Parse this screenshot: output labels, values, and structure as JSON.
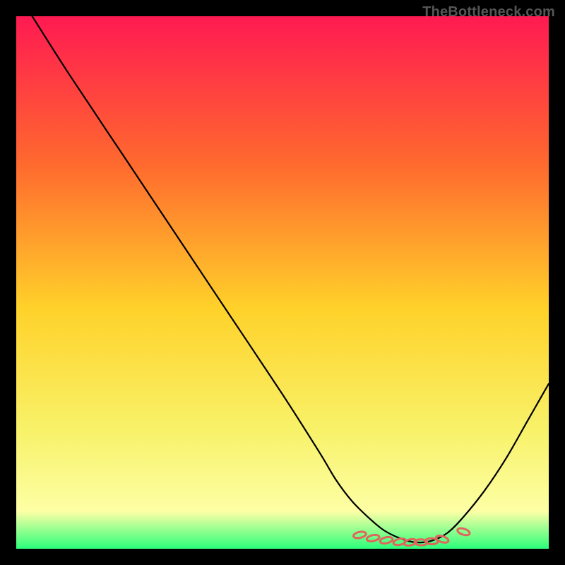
{
  "watermark": "TheBottleneck.com",
  "colors": {
    "background": "#000000",
    "curve": "#000000",
    "marker_stroke": "#e1645d",
    "gradient_top": "#ff1a52",
    "gradient_mid_upper": "#ff6a2e",
    "gradient_mid": "#ffd22a",
    "gradient_mid_lower": "#f8f26a",
    "gradient_bottom_yellow": "#fdffa5",
    "gradient_bottom_green": "#2bff7a"
  },
  "chart_data": {
    "type": "line",
    "title": "",
    "xlabel": "",
    "ylabel": "",
    "xlim": [
      0,
      100
    ],
    "ylim": [
      0,
      100
    ],
    "x": [
      3,
      10,
      20,
      30,
      40,
      50,
      57,
      60,
      63,
      66,
      69,
      72,
      75,
      78,
      81,
      84,
      88,
      92,
      96,
      100
    ],
    "y": [
      100,
      89,
      74,
      59,
      44,
      29,
      18,
      13,
      9,
      6,
      3.5,
      2,
      1.2,
      1.5,
      3,
      6,
      11,
      17,
      24,
      31
    ],
    "markers": {
      "x": [
        64.5,
        67,
        69.5,
        72,
        74,
        76,
        78,
        80,
        84
      ],
      "y": [
        2.6,
        2.0,
        1.6,
        1.3,
        1.2,
        1.2,
        1.4,
        1.8,
        3.2
      ]
    }
  }
}
